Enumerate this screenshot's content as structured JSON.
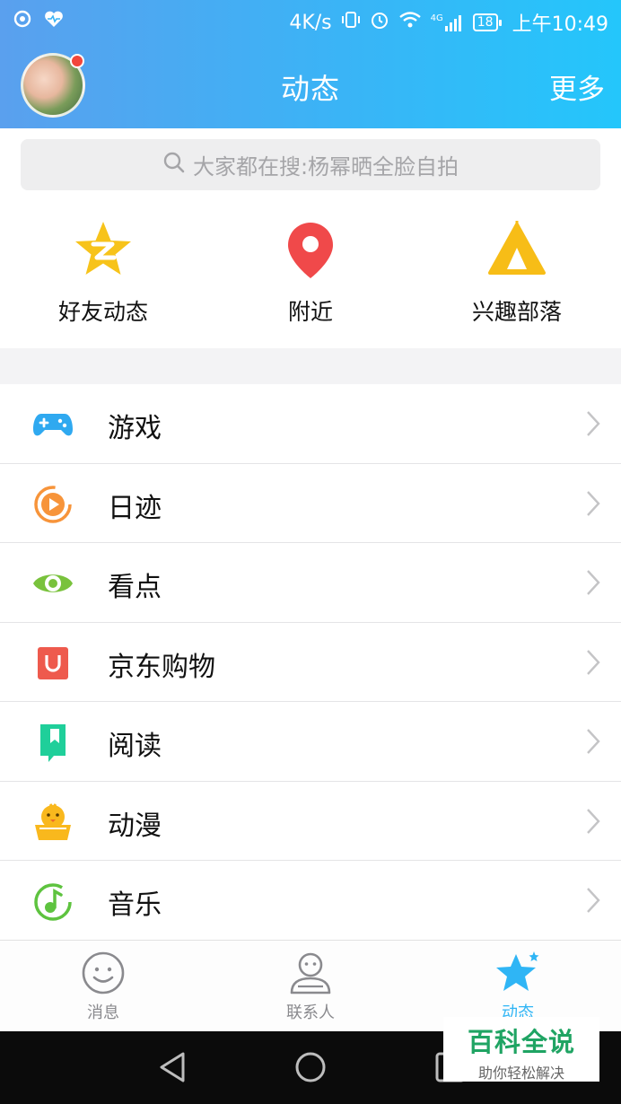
{
  "status_bar": {
    "speed": "4K/s",
    "network": "4G",
    "battery": "18",
    "time": "上午10:49"
  },
  "header": {
    "title": "动态",
    "more_label": "更多",
    "avatar_badge_color": "#f2463b"
  },
  "search": {
    "placeholder": "大家都在搜:杨幂晒全脸自拍"
  },
  "shortcuts": [
    {
      "label": "好友动态",
      "icon": "qzone-star-icon",
      "color": "#f7c31a"
    },
    {
      "label": "附近",
      "icon": "location-pin-icon",
      "color": "#f0494a"
    },
    {
      "label": "兴趣部落",
      "icon": "tent-icon",
      "color": "#f7bd17"
    }
  ],
  "list": [
    {
      "label": "游戏",
      "icon": "gamepad-icon",
      "color": "#2fa9f0"
    },
    {
      "label": "日迹",
      "icon": "play-circle-icon",
      "color": "#f7943a"
    },
    {
      "label": "看点",
      "icon": "eye-icon",
      "color": "#79c23c"
    },
    {
      "label": "京东购物",
      "icon": "jd-shopping-bag-icon",
      "color": "#ee5a4d"
    },
    {
      "label": "阅读",
      "icon": "bookmark-book-icon",
      "color": "#1fcf9a"
    },
    {
      "label": "动漫",
      "icon": "chick-icon",
      "color": "#f9b81d"
    },
    {
      "label": "音乐",
      "icon": "music-note-icon",
      "color": "#5ec33f"
    }
  ],
  "tabs": [
    {
      "label": "消息",
      "icon": "smile-face-icon",
      "active": false
    },
    {
      "label": "联系人",
      "icon": "person-icon",
      "active": false
    },
    {
      "label": "动态",
      "icon": "star-icon",
      "active": true
    }
  ],
  "watermark": {
    "title": "百科全说",
    "subtitle": "助你轻松解决"
  }
}
